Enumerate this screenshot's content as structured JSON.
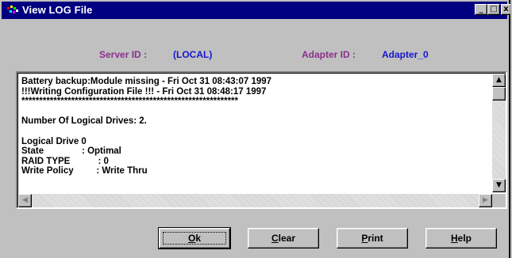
{
  "window": {
    "title": "View LOG File"
  },
  "caption_buttons": {
    "minimize": "_",
    "maximize": "□",
    "close": "x"
  },
  "info": {
    "server_label": "Server ID :",
    "server_value": "(LOCAL)",
    "adapter_label": "Adapter ID :",
    "adapter_value": "Adapter_0"
  },
  "log": {
    "text": "Battery backup:Module missing - Fri Oct 31 08:43:07 1997\n!!!Writing Configuration File !!! - Fri Oct 31 08:48:17 1997\n*************************************************************\n\nNumber Of Logical Drives: 2.\n\nLogical Drive 0\nState               : Optimal\nRAID TYPE           : 0\nWrite Policy         : Write Thru"
  },
  "scroll": {
    "up": "▲",
    "down": "▼",
    "left": "◀",
    "right": "▶"
  },
  "buttons": {
    "ok": {
      "accel": "O",
      "rest": "k"
    },
    "clear": {
      "accel": "C",
      "rest": "lear"
    },
    "print": {
      "accel": "P",
      "rest": "rint"
    },
    "help": {
      "accel": "H",
      "rest": "elp"
    }
  },
  "colors": {
    "title_bar": "#000080",
    "label": "#8b2f8b",
    "value": "#1515d0"
  }
}
